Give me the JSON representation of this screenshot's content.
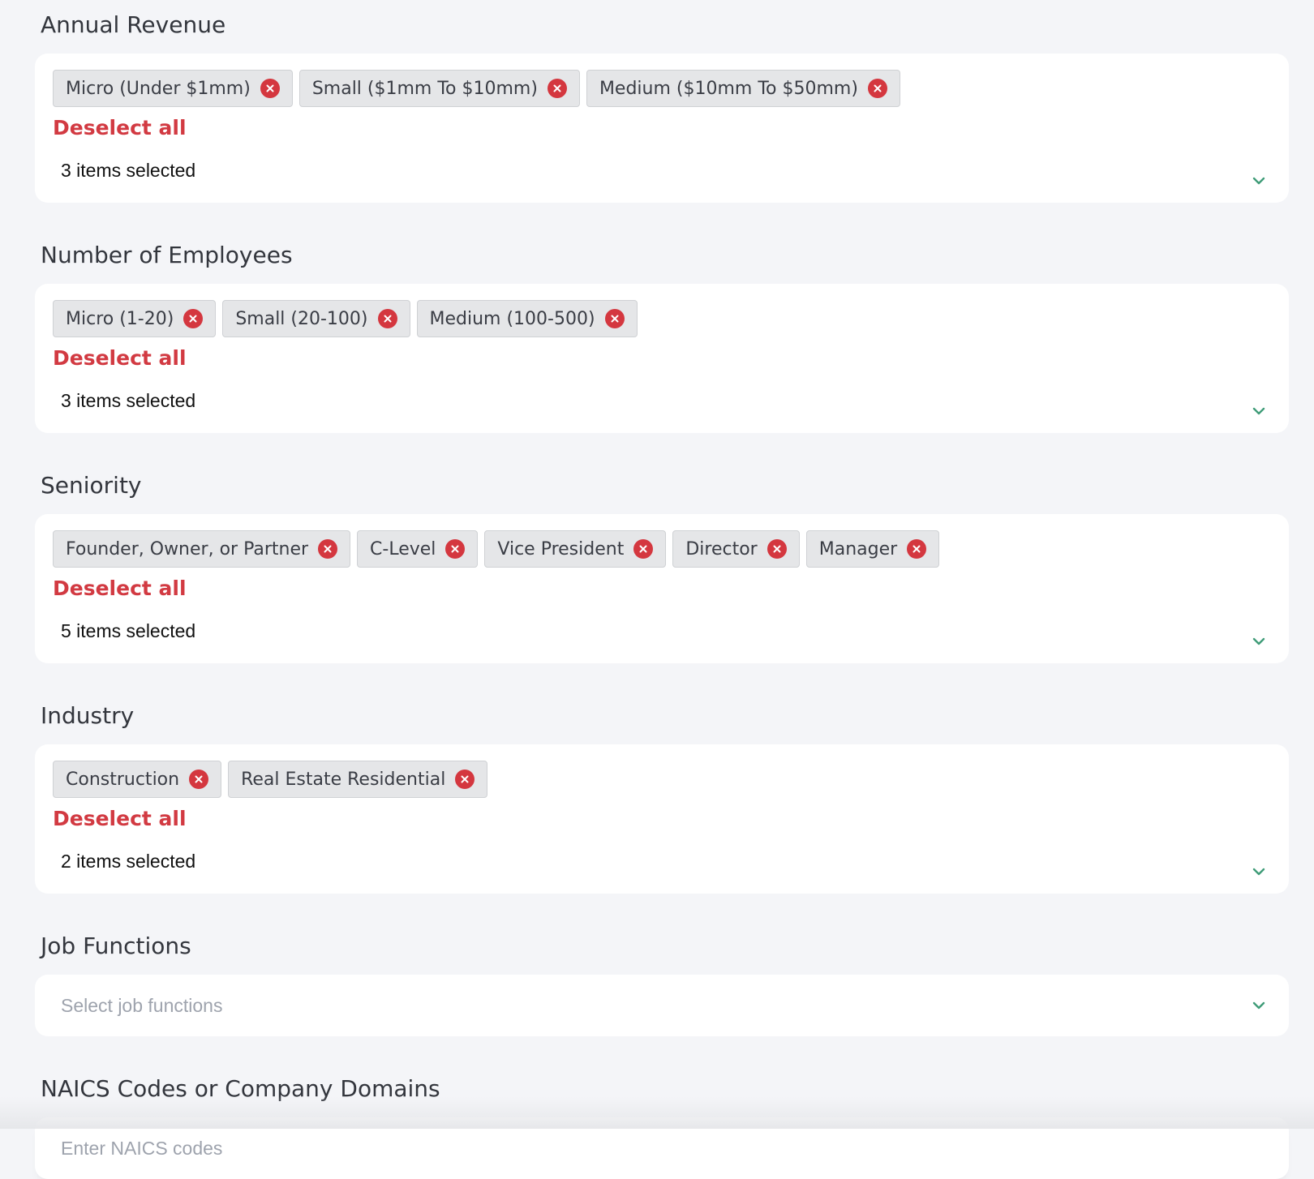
{
  "sections": [
    {
      "label": "Annual Revenue",
      "chips": [
        "Micro (Under $1mm)",
        "Small ($1mm To $10mm)",
        "Medium ($10mm To $50mm)"
      ],
      "deselect_label": "Deselect all",
      "count_text": "3 items selected"
    },
    {
      "label": "Number of Employees",
      "chips": [
        "Micro (1-20)",
        "Small (20-100)",
        "Medium (100-500)"
      ],
      "deselect_label": "Deselect all",
      "count_text": "3 items selected"
    },
    {
      "label": "Seniority",
      "chips": [
        "Founder, Owner, or Partner",
        "C-Level",
        "Vice President",
        "Director",
        "Manager"
      ],
      "deselect_label": "Deselect all",
      "count_text": "5 items selected"
    },
    {
      "label": "Industry",
      "chips": [
        "Construction",
        "Real Estate Residential"
      ],
      "deselect_label": "Deselect all",
      "count_text": "2 items selected"
    }
  ],
  "job_functions": {
    "label": "Job Functions",
    "placeholder": "Select job functions"
  },
  "naics": {
    "label": "NAICS Codes or Company Domains",
    "placeholder": "Enter NAICS codes"
  },
  "colors": {
    "accent_red": "#d23a42",
    "chevron_green": "#3f9c78",
    "chip_bg": "#e5e6e8",
    "page_bg": "#f4f5f8"
  },
  "icons": {
    "chip_remove": "close-circle-icon",
    "dropdown": "chevron-down-icon"
  }
}
